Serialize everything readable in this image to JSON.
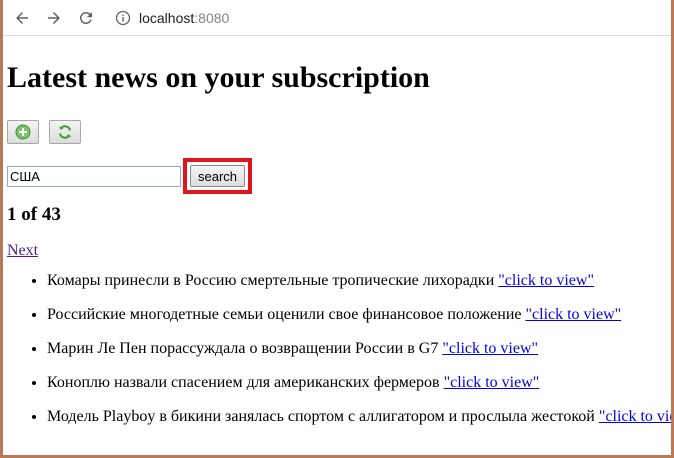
{
  "browser": {
    "url_host": "localhost",
    "url_port": ":8080"
  },
  "page": {
    "title": "Latest news on your subscription",
    "search": {
      "value": "США",
      "button_label": "search"
    },
    "pager": "1 of 43",
    "next_label": "Next",
    "news": [
      {
        "text": "Комары принесли в Россию смертельные тропические лихорадки",
        "link": "\"click to view\""
      },
      {
        "text": "Российские многодетные семьи оценили свое финансовое положение",
        "link": "\"click to view\""
      },
      {
        "text": "Марин Ле Пен порассуждала о возвращении России в G7",
        "link": "\"click to view\""
      },
      {
        "text": "Коноплю назвали спасением для американских фермеров",
        "link": "\"click to view\""
      },
      {
        "text": "Модель Playboy в бикини занялась спортом с аллигатором и прослыла жестокой",
        "link": "\"click to view\""
      }
    ]
  },
  "colors": {
    "highlight": "#e0161e",
    "link": "#0000ee",
    "visited_link": "#551a8b"
  }
}
